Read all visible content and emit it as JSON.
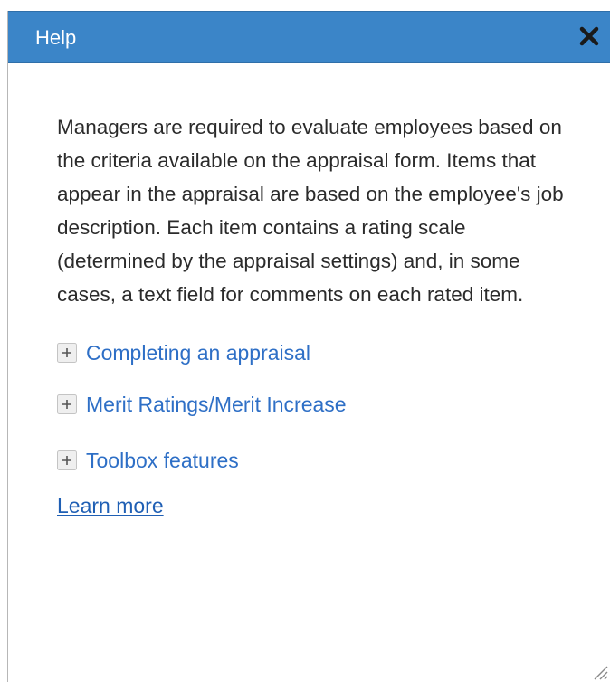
{
  "dialog": {
    "title": "Help",
    "close_icon": "close-icon"
  },
  "content": {
    "description": "Managers are required to evaluate employees based on the criteria available on the appraisal form. Items that appear in the appraisal are based on the employee's job description. Each item contains a rating scale (determined by the appraisal settings) and, in some cases, a text field for comments on each rated item.",
    "sections": [
      {
        "label": "Completing an appraisal",
        "icon": "expand-plus-icon"
      },
      {
        "label": "Merit Ratings/Merit Increase",
        "icon": "expand-plus-icon"
      },
      {
        "label": "Toolbox features",
        "icon": "expand-plus-icon"
      }
    ],
    "learn_more": "Learn more"
  },
  "colors": {
    "title_bar": "#3b85c8",
    "link": "#2e6fc6",
    "text": "#2b2b2b"
  }
}
